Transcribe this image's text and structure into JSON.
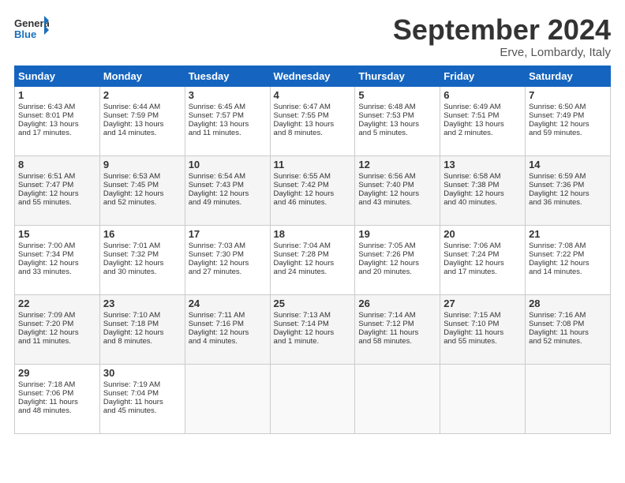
{
  "header": {
    "logo_general": "General",
    "logo_blue": "Blue",
    "month_title": "September 2024",
    "location": "Erve, Lombardy, Italy"
  },
  "weekdays": [
    "Sunday",
    "Monday",
    "Tuesday",
    "Wednesday",
    "Thursday",
    "Friday",
    "Saturday"
  ],
  "weeks": [
    [
      {
        "day": "1",
        "lines": [
          "Sunrise: 6:43 AM",
          "Sunset: 8:01 PM",
          "Daylight: 13 hours",
          "and 17 minutes."
        ]
      },
      {
        "day": "2",
        "lines": [
          "Sunrise: 6:44 AM",
          "Sunset: 7:59 PM",
          "Daylight: 13 hours",
          "and 14 minutes."
        ]
      },
      {
        "day": "3",
        "lines": [
          "Sunrise: 6:45 AM",
          "Sunset: 7:57 PM",
          "Daylight: 13 hours",
          "and 11 minutes."
        ]
      },
      {
        "day": "4",
        "lines": [
          "Sunrise: 6:47 AM",
          "Sunset: 7:55 PM",
          "Daylight: 13 hours",
          "and 8 minutes."
        ]
      },
      {
        "day": "5",
        "lines": [
          "Sunrise: 6:48 AM",
          "Sunset: 7:53 PM",
          "Daylight: 13 hours",
          "and 5 minutes."
        ]
      },
      {
        "day": "6",
        "lines": [
          "Sunrise: 6:49 AM",
          "Sunset: 7:51 PM",
          "Daylight: 13 hours",
          "and 2 minutes."
        ]
      },
      {
        "day": "7",
        "lines": [
          "Sunrise: 6:50 AM",
          "Sunset: 7:49 PM",
          "Daylight: 12 hours",
          "and 59 minutes."
        ]
      }
    ],
    [
      {
        "day": "8",
        "lines": [
          "Sunrise: 6:51 AM",
          "Sunset: 7:47 PM",
          "Daylight: 12 hours",
          "and 55 minutes."
        ]
      },
      {
        "day": "9",
        "lines": [
          "Sunrise: 6:53 AM",
          "Sunset: 7:45 PM",
          "Daylight: 12 hours",
          "and 52 minutes."
        ]
      },
      {
        "day": "10",
        "lines": [
          "Sunrise: 6:54 AM",
          "Sunset: 7:43 PM",
          "Daylight: 12 hours",
          "and 49 minutes."
        ]
      },
      {
        "day": "11",
        "lines": [
          "Sunrise: 6:55 AM",
          "Sunset: 7:42 PM",
          "Daylight: 12 hours",
          "and 46 minutes."
        ]
      },
      {
        "day": "12",
        "lines": [
          "Sunrise: 6:56 AM",
          "Sunset: 7:40 PM",
          "Daylight: 12 hours",
          "and 43 minutes."
        ]
      },
      {
        "day": "13",
        "lines": [
          "Sunrise: 6:58 AM",
          "Sunset: 7:38 PM",
          "Daylight: 12 hours",
          "and 40 minutes."
        ]
      },
      {
        "day": "14",
        "lines": [
          "Sunrise: 6:59 AM",
          "Sunset: 7:36 PM",
          "Daylight: 12 hours",
          "and 36 minutes."
        ]
      }
    ],
    [
      {
        "day": "15",
        "lines": [
          "Sunrise: 7:00 AM",
          "Sunset: 7:34 PM",
          "Daylight: 12 hours",
          "and 33 minutes."
        ]
      },
      {
        "day": "16",
        "lines": [
          "Sunrise: 7:01 AM",
          "Sunset: 7:32 PM",
          "Daylight: 12 hours",
          "and 30 minutes."
        ]
      },
      {
        "day": "17",
        "lines": [
          "Sunrise: 7:03 AM",
          "Sunset: 7:30 PM",
          "Daylight: 12 hours",
          "and 27 minutes."
        ]
      },
      {
        "day": "18",
        "lines": [
          "Sunrise: 7:04 AM",
          "Sunset: 7:28 PM",
          "Daylight: 12 hours",
          "and 24 minutes."
        ]
      },
      {
        "day": "19",
        "lines": [
          "Sunrise: 7:05 AM",
          "Sunset: 7:26 PM",
          "Daylight: 12 hours",
          "and 20 minutes."
        ]
      },
      {
        "day": "20",
        "lines": [
          "Sunrise: 7:06 AM",
          "Sunset: 7:24 PM",
          "Daylight: 12 hours",
          "and 17 minutes."
        ]
      },
      {
        "day": "21",
        "lines": [
          "Sunrise: 7:08 AM",
          "Sunset: 7:22 PM",
          "Daylight: 12 hours",
          "and 14 minutes."
        ]
      }
    ],
    [
      {
        "day": "22",
        "lines": [
          "Sunrise: 7:09 AM",
          "Sunset: 7:20 PM",
          "Daylight: 12 hours",
          "and 11 minutes."
        ]
      },
      {
        "day": "23",
        "lines": [
          "Sunrise: 7:10 AM",
          "Sunset: 7:18 PM",
          "Daylight: 12 hours",
          "and 8 minutes."
        ]
      },
      {
        "day": "24",
        "lines": [
          "Sunrise: 7:11 AM",
          "Sunset: 7:16 PM",
          "Daylight: 12 hours",
          "and 4 minutes."
        ]
      },
      {
        "day": "25",
        "lines": [
          "Sunrise: 7:13 AM",
          "Sunset: 7:14 PM",
          "Daylight: 12 hours",
          "and 1 minute."
        ]
      },
      {
        "day": "26",
        "lines": [
          "Sunrise: 7:14 AM",
          "Sunset: 7:12 PM",
          "Daylight: 11 hours",
          "and 58 minutes."
        ]
      },
      {
        "day": "27",
        "lines": [
          "Sunrise: 7:15 AM",
          "Sunset: 7:10 PM",
          "Daylight: 11 hours",
          "and 55 minutes."
        ]
      },
      {
        "day": "28",
        "lines": [
          "Sunrise: 7:16 AM",
          "Sunset: 7:08 PM",
          "Daylight: 11 hours",
          "and 52 minutes."
        ]
      }
    ],
    [
      {
        "day": "29",
        "lines": [
          "Sunrise: 7:18 AM",
          "Sunset: 7:06 PM",
          "Daylight: 11 hours",
          "and 48 minutes."
        ]
      },
      {
        "day": "30",
        "lines": [
          "Sunrise: 7:19 AM",
          "Sunset: 7:04 PM",
          "Daylight: 11 hours",
          "and 45 minutes."
        ]
      },
      {
        "day": "",
        "lines": []
      },
      {
        "day": "",
        "lines": []
      },
      {
        "day": "",
        "lines": []
      },
      {
        "day": "",
        "lines": []
      },
      {
        "day": "",
        "lines": []
      }
    ]
  ]
}
